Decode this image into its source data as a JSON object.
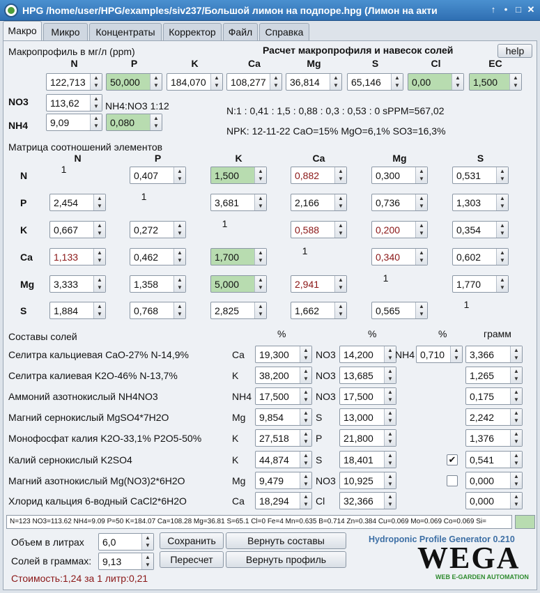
{
  "window": {
    "title": "HPG /home/user/HPG/examples/siv237/Большой лимон на подпоре.hpg (Лимон на акти",
    "ctrl_up": "↑",
    "ctrl_min": "•",
    "ctrl_max": "□",
    "ctrl_close": "✕"
  },
  "tabs": [
    "Макро",
    "Микро",
    "Концентраты",
    "Корректор",
    "Файл",
    "Справка"
  ],
  "macro": {
    "profile_label": "Макропрофиль в мг/л (ppm)",
    "calc_title": "Расчет макропрофиля и навесок солей",
    "help": "help",
    "headers": [
      "N",
      "P",
      "K",
      "Ca",
      "Mg",
      "S",
      "Cl",
      "EC"
    ],
    "values": [
      "122,713",
      "50,000",
      "184,070",
      "108,277",
      "36,814",
      "65,146",
      "0,00",
      "1,500"
    ],
    "no3_label": "NO3",
    "no3_value": "113,62",
    "ratio_label": "NH4:NO3 1:12",
    "nh4_label": "NH4",
    "nh4_value": "9,09",
    "nh4_ratio": "0,080",
    "ratio_line": "N:1 : 0,41 : 1,5 : 0,88 : 0,3 : 0,53 : 0 sPPM=567,02",
    "npk_line": "NPK: 12-11-22 CaO=15% MgO=6,1% SO3=16,3%"
  },
  "matrix": {
    "title": "Матрица соотношений элементов",
    "cols": [
      "N",
      "P",
      "K",
      "Ca",
      "Mg",
      "S"
    ],
    "rows": [
      {
        "name": "N",
        "cells": [
          "1",
          "0,407",
          "1,500",
          "0,882",
          "0,300",
          "0,531"
        ]
      },
      {
        "name": "P",
        "cells": [
          "2,454",
          "1",
          "3,681",
          "2,166",
          "0,736",
          "1,303"
        ]
      },
      {
        "name": "K",
        "cells": [
          "0,667",
          "0,272",
          "1",
          "0,588",
          "0,200",
          "0,354"
        ]
      },
      {
        "name": "Ca",
        "cells": [
          "1,133",
          "0,462",
          "1,700",
          "1",
          "0,340",
          "0,602"
        ]
      },
      {
        "name": "Mg",
        "cells": [
          "3,333",
          "1,358",
          "5,000",
          "2,941",
          "1",
          "1,770"
        ]
      },
      {
        "name": "S",
        "cells": [
          "1,884",
          "0,768",
          "2,825",
          "1,662",
          "0,565",
          "1"
        ]
      }
    ]
  },
  "salts": {
    "title": "Составы солей",
    "pct": "%",
    "gram": "грамм",
    "rows": [
      {
        "name": "Селитра кальциевая CaO-27% N-14,9%",
        "e1": "Ca",
        "v1": "19,300",
        "e2": "NO3",
        "v2": "14,200",
        "e3": "NH4",
        "v3": "0,710",
        "grams": "3,366"
      },
      {
        "name": "Селитра калиевая K2O-46% N-13,7%",
        "e1": "K",
        "v1": "38,200",
        "e2": "NO3",
        "v2": "13,685",
        "grams": "1,265"
      },
      {
        "name": "Аммоний азотнокислый NH4NO3",
        "e1": "NH4",
        "v1": "17,500",
        "e2": "NO3",
        "v2": "17,500",
        "grams": "0,175"
      },
      {
        "name": "Магний сернокислый MgSO4*7H2O",
        "e1": "Mg",
        "v1": "9,854",
        "e2": "S",
        "v2": "13,000",
        "grams": "2,242"
      },
      {
        "name": "Монофосфат калия K2O-33,1% P2O5-50%",
        "e1": "K",
        "v1": "27,518",
        "e2": "P",
        "v2": "21,800",
        "grams": "1,376"
      },
      {
        "name": "Калий сернокислый K2SO4",
        "e1": "K",
        "v1": "44,874",
        "e2": "S",
        "v2": "18,401",
        "check": "✔",
        "grams": "0,541"
      },
      {
        "name": "Магний азотнокислый Mg(NO3)2*6H2O",
        "e1": "Mg",
        "v1": "9,479",
        "e2": "NO3",
        "v2": "10,925",
        "check": "",
        "grams": "0,000"
      },
      {
        "name": "Хлорид кальция 6-водный CaCl2*6H2O",
        "e1": "Ca",
        "v1": "18,294",
        "e2": "Cl",
        "v2": "32,366",
        "grams": "0,000"
      }
    ]
  },
  "status_line": "N=123 NO3=113.62 NH4=9.09 P=50 K=184.07 Ca=108.28 Mg=36.81 S=65.1 Cl=0 Fe=4 Mn=0.635 B=0.714 Zn=0.384 Cu=0.069 Mo=0.069 Co=0.069 Si=",
  "bottom": {
    "volume_label": "Объем в литрах",
    "volume": "6,0",
    "salts_label": "Солей в граммах:",
    "salts": "9,13",
    "save": "Сохранить",
    "restore_salts": "Вернуть составы",
    "recalc": "Пересчет",
    "restore_profile": "Вернуть профиль",
    "cost": "Стоимость:1,24 за 1 литр:0,21",
    "version": "Hydroponic Profile Generator 0.210",
    "logo": "WEGA",
    "logo_sub": "WEB E-GARDEN AUTOMATION"
  },
  "colors": {
    "green": "#b8dcb0",
    "red_text": "#8a1616",
    "title_blue": "#2f6fb3",
    "logo_green": "#2e8b2e"
  }
}
